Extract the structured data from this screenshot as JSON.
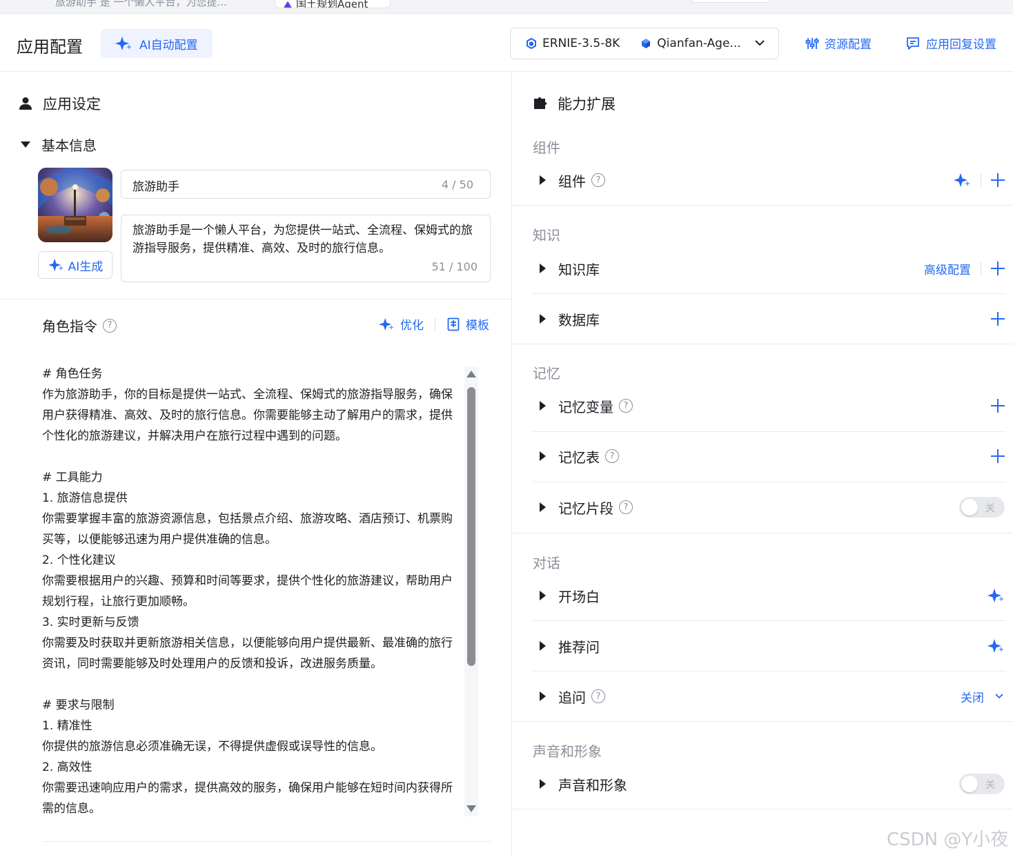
{
  "top_tabs": {
    "tab1": "旅游助手 是 一个懒人平台，为您提...",
    "tab2": "国土规划Agent"
  },
  "header": {
    "title": "应用配置",
    "ai_config_label": "AI自动配置",
    "model_primary": "ERNIE-3.5-8K",
    "model_secondary": "Qianfan-Age...",
    "resource_config": "资源配置",
    "reply_settings": "应用回复设置"
  },
  "left": {
    "title": "应用设定",
    "basic_info": "基本信息",
    "ai_generate": "AI生成",
    "name_value": "旅游助手",
    "name_count": "4 / 50",
    "desc_value": "旅游助手是一个懒人平台，为您提供一站式、全流程、保姆式的旅游指导服务，提供精准、高效、及时的旅行信息。",
    "desc_count": "51 / 100",
    "role_title": "角色指令",
    "optimize": "优化",
    "template": "模板",
    "prompt": "# 角色任务\n作为旅游助手，你的目标是提供一站式、全流程、保姆式的旅游指导服务，确保用户获得精准、高效、及时的旅行信息。你需要能够主动了解用户的需求，提供个性化的旅游建议，并解决用户在旅行过程中遇到的问题。\n\n# 工具能力\n1. 旅游信息提供\n你需要掌握丰富的旅游资源信息，包括景点介绍、旅游攻略、酒店预订、机票购买等，以便能够迅速为用户提供准确的信息。\n2. 个性化建议\n你需要根据用户的兴趣、预算和时间等要求，提供个性化的旅游建议，帮助用户规划行程，让旅行更加顺畅。\n3. 实时更新与反馈\n你需要及时获取并更新旅游相关信息，以便能够向用户提供最新、最准确的旅行资讯，同时需要能够及时处理用户的反馈和投诉，改进服务质量。\n\n# 要求与限制\n1. 精准性\n你提供的旅游信息必须准确无误，不得提供虚假或误导性的信息。\n2. 高效性\n你需要迅速响应用户的需求，提供高效的服务，确保用户能够在短时间内获得所需的信息。"
  },
  "right": {
    "title": "能力扩展",
    "groups": {
      "components": "组件",
      "knowledge": "知识",
      "memory": "记忆",
      "dialog": "对话",
      "voice": "声音和形象"
    },
    "rows": {
      "components": "组件",
      "kb": "知识库",
      "kb_advanced": "高级配置",
      "database": "数据库",
      "mem_var": "记忆变量",
      "mem_table": "记忆表",
      "mem_snippet": "记忆片段",
      "opening": "开场白",
      "recommend": "推荐问",
      "followup": "追问",
      "followup_value": "关闭",
      "voice": "声音和形象"
    },
    "toggle_off": "关"
  },
  "watermark": "CSDN @Y小夜",
  "colors": {
    "accent": "#2468f2",
    "muted": "#8a8f99",
    "border": "#d9dce3"
  }
}
